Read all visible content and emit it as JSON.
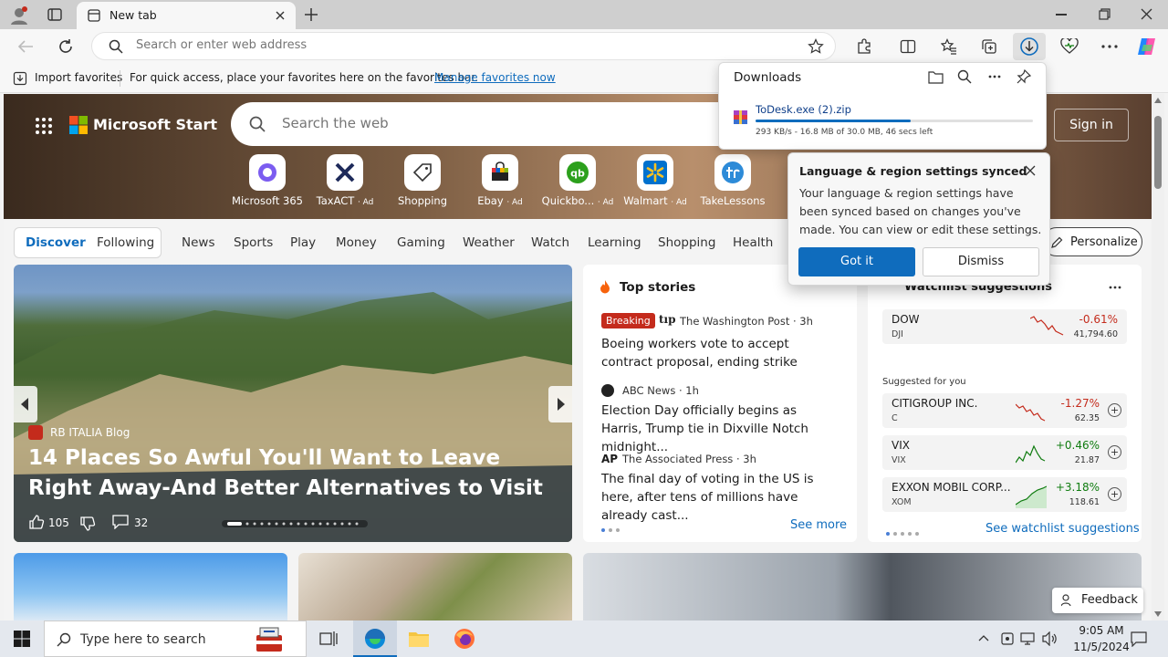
{
  "browser": {
    "tab_title": "New tab",
    "address_placeholder": "Search or enter web address"
  },
  "favorites_bar": {
    "import_label": "Import favorites",
    "hint": "For quick access, place your favorites here on the favorites bar.",
    "manage_link": "Manage favorites now"
  },
  "downloads": {
    "title": "Downloads",
    "file_name": "ToDesk.exe (2).zip",
    "status": "293 KB/s - 16.8 MB of 30.0 MB, 46 secs left",
    "progress": 0.56
  },
  "popup": {
    "title": "Language & region settings synced",
    "body": "Your language & region settings have been synced based on changes you've made. You can view or edit these settings.",
    "got_it": "Got it",
    "dismiss": "Dismiss"
  },
  "start": {
    "brand": "Microsoft Start",
    "search_placeholder": "Search the web",
    "sign_in": "Sign in",
    "apps": [
      {
        "label": "Microsoft 365",
        "ad": ""
      },
      {
        "label": "TaxACT",
        "ad": "· Ad"
      },
      {
        "label": "Shopping",
        "ad": ""
      },
      {
        "label": "Ebay",
        "ad": "· Ad"
      },
      {
        "label": "Quickbo...",
        "ad": "· Ad"
      },
      {
        "label": "Walmart",
        "ad": "· Ad"
      },
      {
        "label": "TakeLessons",
        "ad": ""
      }
    ],
    "tabs": {
      "discover": "Discover",
      "following": "Following"
    },
    "nav": [
      "News",
      "Sports",
      "Play",
      "Money",
      "Gaming",
      "Weather",
      "Watch",
      "Learning",
      "Shopping",
      "Health"
    ],
    "personalize": "Personalize"
  },
  "hero_story": {
    "source": "RB ITALIA Blog",
    "title": "14 Places So Awful You'll Want to Leave Right Away-And Better Alternatives to Visit",
    "likes": "105",
    "comments": "32"
  },
  "top_stories": {
    "heading": "Top stories",
    "items": [
      {
        "badge": "Breaking",
        "source": "The Washington Post · 3h",
        "headline": "Boeing workers vote to accept contract proposal, ending strike"
      },
      {
        "badge": "",
        "source": "ABC News · 1h",
        "headline": "Election Day officially begins as Harris, Trump tie in Dixville Notch midnight..."
      },
      {
        "badge": "",
        "source": "The Associated Press · 3h",
        "headline": "The final day of voting in the US is here, after tens of millions have already cast..."
      }
    ],
    "see_more": "See more"
  },
  "watchlist": {
    "heading": "Watchlist suggestions",
    "suggested_label": "Suggested for you",
    "see_link": "See watchlist suggestions",
    "stocks": [
      {
        "name": "DOW",
        "symbol": "DJI",
        "change": "-0.61%",
        "price": "41,794.60",
        "dir": "down"
      },
      {
        "name": "CITIGROUP INC.",
        "symbol": "C",
        "change": "-1.27%",
        "price": "62.35",
        "dir": "down"
      },
      {
        "name": "VIX",
        "symbol": "VIX",
        "change": "+0.46%",
        "price": "21.87",
        "dir": "up"
      },
      {
        "name": "EXXON MOBIL CORP...",
        "symbol": "XOM",
        "change": "+3.18%",
        "price": "118.61",
        "dir": "up"
      }
    ]
  },
  "feedback": "Feedback",
  "taskbar": {
    "search_placeholder": "Type here to search",
    "time": "9:05 AM",
    "date": "11/5/2024"
  },
  "colors": {
    "accent": "#0f6cbd",
    "button_blue": "#0f6cbd",
    "red": "#c42b1c",
    "green": "#107c10"
  }
}
